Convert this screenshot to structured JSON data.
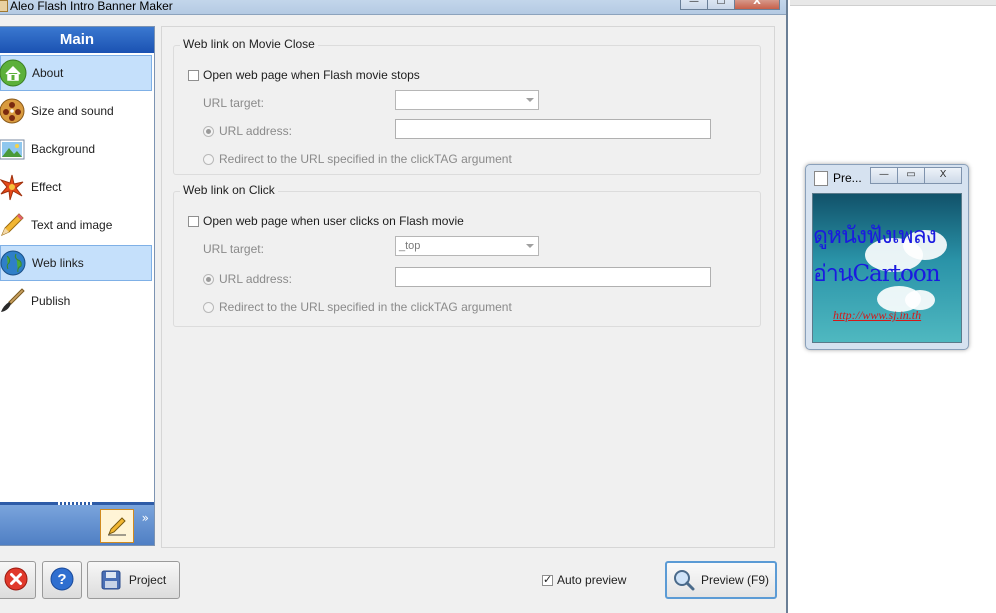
{
  "window": {
    "title": "Aleo Flash Intro Banner Maker",
    "minimize": "—",
    "maximize": "☐",
    "close": "X"
  },
  "sidebar": {
    "header": "Main",
    "items": [
      {
        "label": "About",
        "icon": "home-icon",
        "active": true
      },
      {
        "label": "Size and sound",
        "icon": "film-reel-icon",
        "active": false
      },
      {
        "label": "Background",
        "icon": "landscape-picture-icon",
        "active": false
      },
      {
        "label": "Effect",
        "icon": "sparkle-icon",
        "active": false
      },
      {
        "label": "Text and image",
        "icon": "pencil-icon",
        "active": false
      },
      {
        "label": "Web links",
        "icon": "globe-icon",
        "active": true
      },
      {
        "label": "Publish",
        "icon": "brush-icon",
        "active": false
      }
    ],
    "chevron": "»",
    "edit_icon": "pencil-edit-icon"
  },
  "movie_close": {
    "title": "Web link on Movie Close",
    "open_label": "Open web page when Flash movie stops",
    "open_checked": false,
    "url_target_label": "URL target:",
    "url_target_value": "",
    "url_address_label": "URL address:",
    "url_address_value": "",
    "redirect_label": "Redirect to the URL specified in the clickTAG argument"
  },
  "on_click": {
    "title": "Web link on Click",
    "open_label": "Open web page when user clicks on Flash movie",
    "open_checked": false,
    "url_target_label": "URL target:",
    "url_target_value": "_top",
    "url_address_label": "URL address:",
    "url_address_value": "",
    "redirect_label": "Redirect to the URL specified in the clickTAG argument"
  },
  "footer": {
    "project_label": "Project",
    "auto_preview_label": "Auto preview",
    "auto_preview_checked": true,
    "preview_label": "Preview (F9)"
  },
  "preview_window": {
    "title": "Pre...",
    "minimize": "—",
    "restore": "▭",
    "close": "X",
    "banner_line1": "ดูหนังฟังเพลง",
    "banner_line2": "อ่านCartoon",
    "banner_url": "http://www.sj.in.th"
  },
  "colors": {
    "sidebar_header": "#1b52b2",
    "active_item": "#c5e0fb",
    "banner_text": "#1a1ae0",
    "banner_url": "#d41818"
  }
}
